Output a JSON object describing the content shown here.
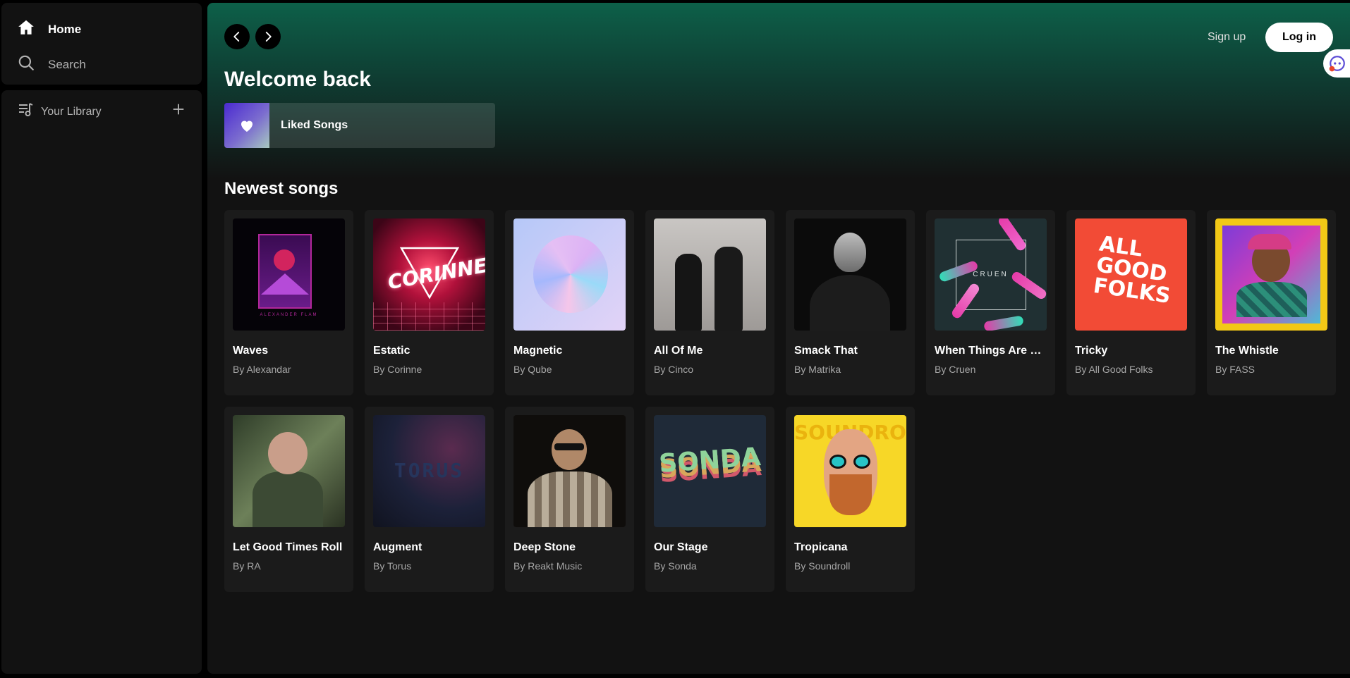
{
  "sidebar": {
    "home_label": "Home",
    "search_label": "Search",
    "library_label": "Your Library"
  },
  "header": {
    "signup_label": "Sign up",
    "login_label": "Log in"
  },
  "main": {
    "welcome_title": "Welcome back",
    "liked_songs_label": "Liked Songs",
    "section_title": "Newest songs",
    "songs": [
      {
        "title": "Waves",
        "artist": "By Alexandar",
        "cover_text": "ALEXANDER FLAM"
      },
      {
        "title": "Estatic",
        "artist": "By Corinne",
        "cover_text": "CORINNE"
      },
      {
        "title": "Magnetic",
        "artist": "By Qube"
      },
      {
        "title": "All Of Me",
        "artist": "By Cinco"
      },
      {
        "title": "Smack That",
        "artist": "By Matrika"
      },
      {
        "title": "When Things Are Fl...",
        "artist": "By Cruen",
        "cover_text": "CRUEN"
      },
      {
        "title": "Tricky",
        "artist": "By All Good Folks",
        "cover_text": "ALL GOOD FOLKS"
      },
      {
        "title": "The Whistle",
        "artist": "By FASS"
      },
      {
        "title": "Let Good Times Roll",
        "artist": "By RA"
      },
      {
        "title": "Augment",
        "artist": "By Torus",
        "cover_text": "TORUS"
      },
      {
        "title": "Deep Stone",
        "artist": "By Reakt Music"
      },
      {
        "title": "Our Stage",
        "artist": "By Sonda",
        "cover_text": "SONDA"
      },
      {
        "title": "Tropicana",
        "artist": "By Soundroll",
        "cover_text": "SOUNDROLL"
      }
    ]
  },
  "colors": {
    "accent_green": "#0d6049",
    "background": "#121212",
    "card": "#1b1b1b"
  }
}
